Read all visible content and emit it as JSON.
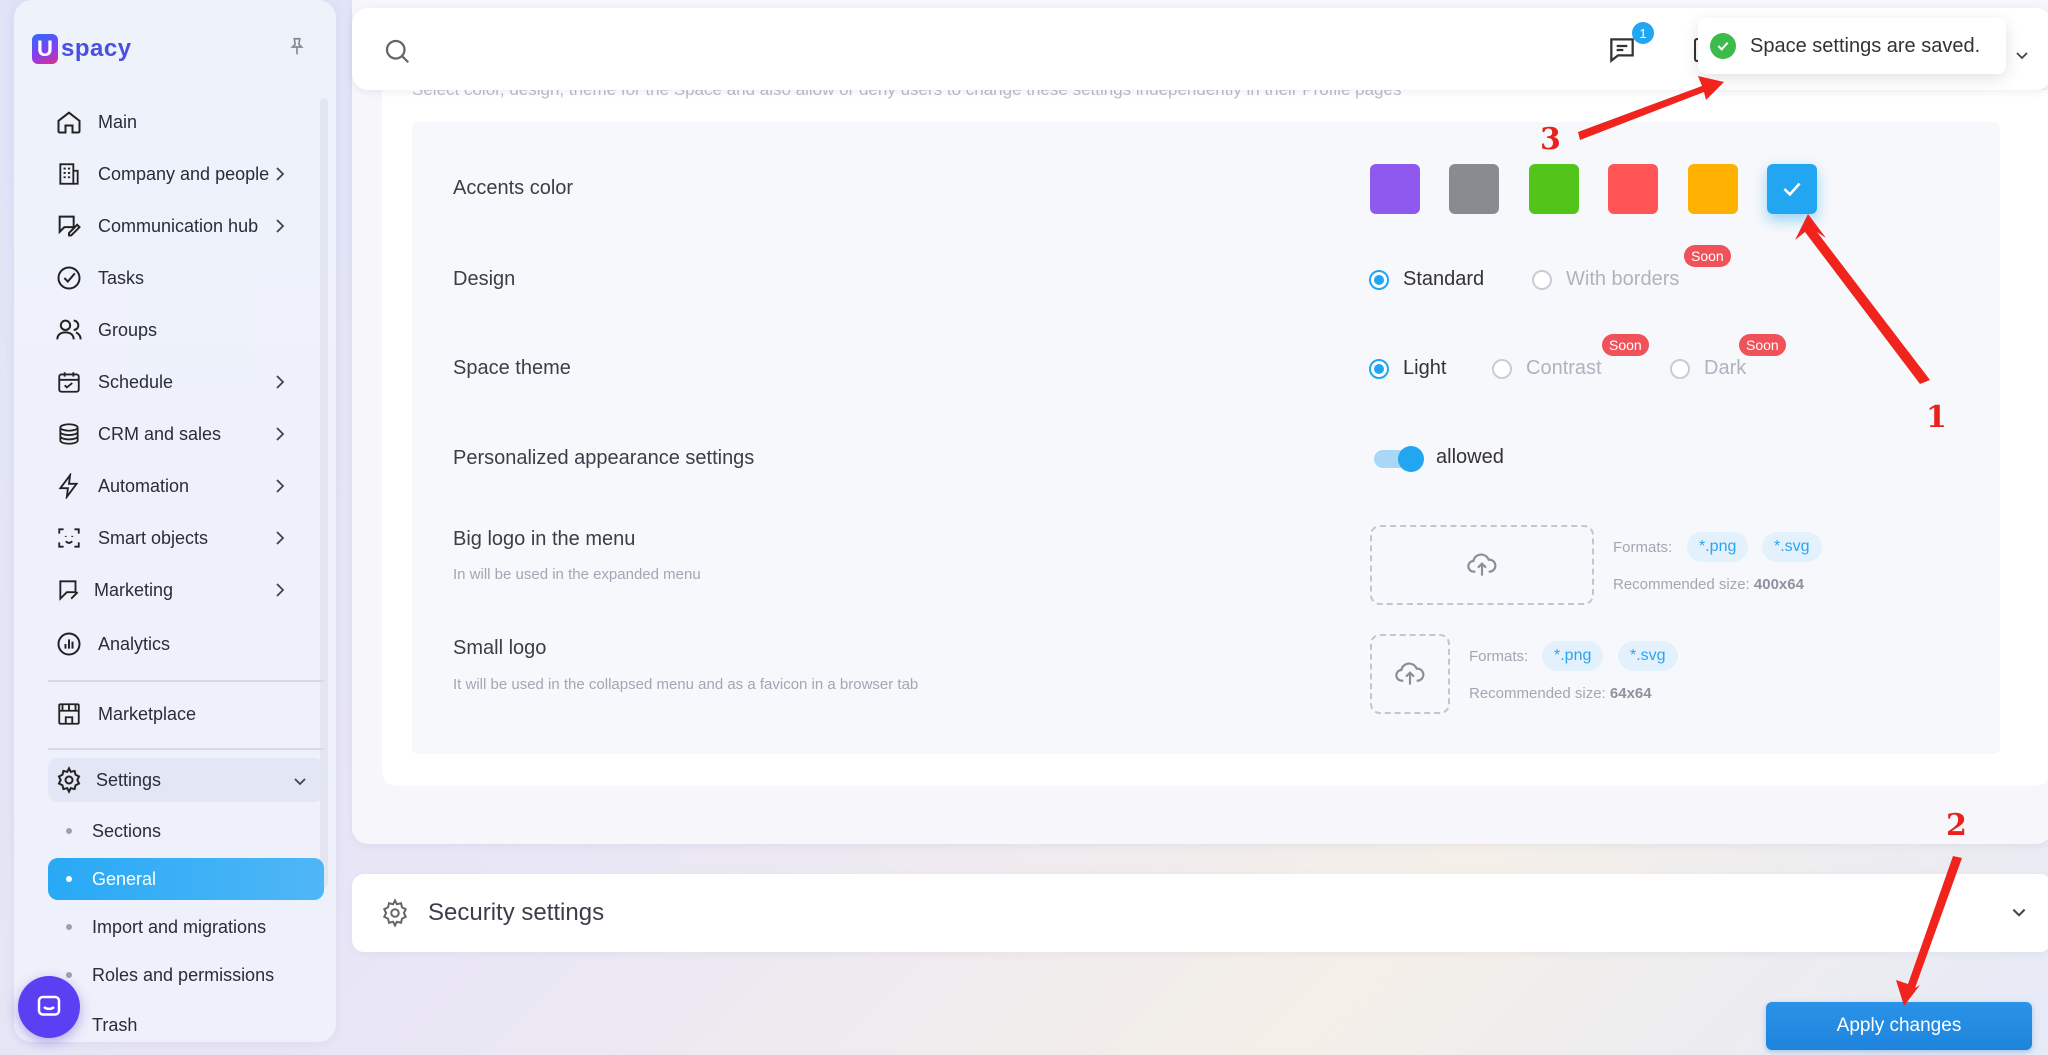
{
  "brand": {
    "logo_text": "spacy",
    "logo_mark": "U"
  },
  "sidebar": {
    "items": [
      {
        "label": "Main",
        "icon": "home-icon"
      },
      {
        "label": "Company and people",
        "icon": "building-icon"
      },
      {
        "label": "Communication hub",
        "icon": "chat-edit-icon"
      },
      {
        "label": "Tasks",
        "icon": "check-circle-icon"
      },
      {
        "label": "Groups",
        "icon": "users-icon"
      },
      {
        "label": "Schedule",
        "icon": "calendar-icon"
      },
      {
        "label": "CRM and sales",
        "icon": "coins-icon"
      },
      {
        "label": "Automation",
        "icon": "bolt-icon"
      },
      {
        "label": "Smart objects",
        "icon": "scan-face-icon"
      },
      {
        "label": "Marketing",
        "icon": "marketing-icon"
      },
      {
        "label": "Analytics",
        "icon": "chart-icon"
      },
      {
        "label": "Marketplace",
        "icon": "store-icon"
      },
      {
        "label": "Settings",
        "icon": "gear-icon"
      }
    ],
    "sub_items": [
      {
        "label": "Sections"
      },
      {
        "label": "General"
      },
      {
        "label": "Import and migrations"
      },
      {
        "label": "Roles and permissions"
      },
      {
        "label": "Trash"
      }
    ]
  },
  "header": {
    "message_count": "1"
  },
  "toast": {
    "text": "Space settings are saved."
  },
  "appearance": {
    "description": "Select color, design, theme for the Space and also allow or deny users to change these settings independently in their Profile pages",
    "accents_label": "Accents color",
    "accent_colors": [
      "#8f59f0",
      "#8a8b90",
      "#52c41a",
      "#ff5557",
      "#ffb000",
      "#22a6f2"
    ],
    "design_label": "Design",
    "design_options": {
      "standard": "Standard",
      "with_borders": "With borders"
    },
    "soon": "Soon",
    "theme_label": "Space theme",
    "theme_options": {
      "light": "Light",
      "contrast": "Contrast",
      "dark": "Dark"
    },
    "personalized_label": "Personalized appearance settings",
    "personalized_value": "allowed",
    "big_logo_label": "Big logo in the menu",
    "big_logo_sub": "In will be used in the expanded menu",
    "small_logo_label": "Small logo",
    "small_logo_sub": "It will be used in the collapsed menu and as a favicon in a browser tab",
    "formats_label": "Formats:",
    "format_png": "*.png",
    "format_svg": "*.svg",
    "recommended_label": "Recommended size:",
    "big_size": "400x64",
    "small_size": "64x64"
  },
  "security": {
    "title": "Security settings"
  },
  "actions": {
    "apply": "Apply changes"
  },
  "annotations": {
    "n1": "1",
    "n2": "2",
    "n3": "3"
  }
}
